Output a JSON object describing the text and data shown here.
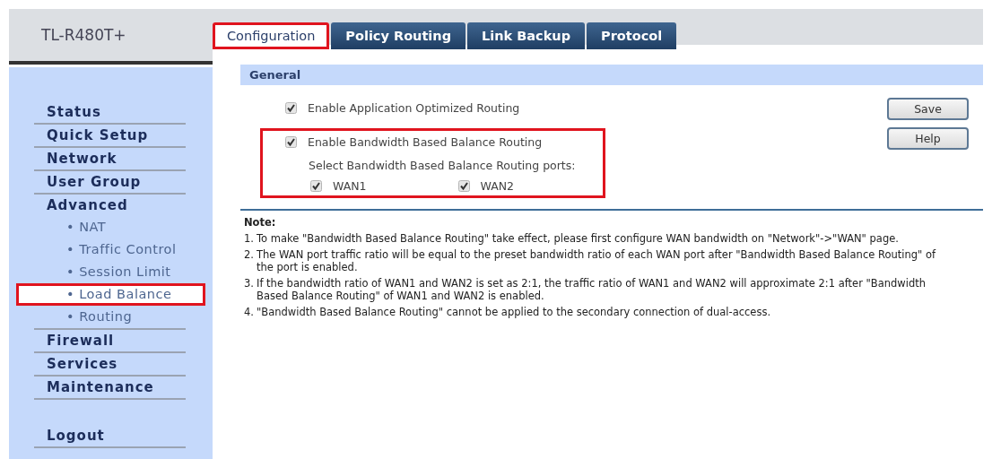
{
  "brand": "TL-R480T+",
  "tabs": [
    {
      "label": "Configuration",
      "selected": true,
      "highlighted": true
    },
    {
      "label": "Policy Routing",
      "selected": false,
      "highlighted": false
    },
    {
      "label": "Link Backup",
      "selected": false,
      "highlighted": false
    },
    {
      "label": "Protocol",
      "selected": false,
      "highlighted": false
    }
  ],
  "sidebar": {
    "items": [
      {
        "label": "Status",
        "kind": "section",
        "selected": false,
        "highlighted": false
      },
      {
        "label": "Quick Setup",
        "kind": "section",
        "selected": false,
        "highlighted": false
      },
      {
        "label": "Network",
        "kind": "section",
        "selected": false,
        "highlighted": false
      },
      {
        "label": "User Group",
        "kind": "section",
        "selected": false,
        "highlighted": false
      },
      {
        "label": "Advanced",
        "kind": "section",
        "selected": false,
        "highlighted": false,
        "children": [
          {
            "label": "• NAT",
            "selected": false,
            "highlighted": false
          },
          {
            "label": "• Traffic Control",
            "selected": false,
            "highlighted": false
          },
          {
            "label": "• Session Limit",
            "selected": false,
            "highlighted": false
          },
          {
            "label": "• Load Balance",
            "selected": true,
            "highlighted": true
          },
          {
            "label": "• Routing",
            "selected": false,
            "highlighted": false
          }
        ]
      },
      {
        "label": "Firewall",
        "kind": "section",
        "selected": false,
        "highlighted": false
      },
      {
        "label": "Services",
        "kind": "section",
        "selected": false,
        "highlighted": false
      },
      {
        "label": "Maintenance",
        "kind": "section",
        "selected": false,
        "highlighted": false
      },
      {
        "label": "Logout",
        "kind": "logout",
        "selected": false,
        "highlighted": false
      }
    ]
  },
  "general": {
    "title": "General",
    "options": [
      {
        "label": "Enable Application Optimized Routing",
        "checked": true
      }
    ],
    "bandwidth_group": {
      "highlighted": true,
      "option": {
        "label": "Enable Bandwidth Based Balance Routing",
        "checked": true
      },
      "ports_label": "Select Bandwidth Based Balance Routing ports:",
      "ports": [
        {
          "label": "WAN1",
          "checked": true
        },
        {
          "label": "WAN2",
          "checked": true
        }
      ]
    },
    "buttons": [
      "Save",
      "Help"
    ]
  },
  "note": {
    "title": "Note:",
    "items": [
      {
        "number": "1.",
        "text": "To make \"Bandwidth Based Balance Routing\" take effect, please first configure WAN bandwidth on \"Network\"->\"WAN\" page."
      },
      {
        "number": "2.",
        "text": "The WAN port traffic ratio will be equal to the preset bandwidth ratio of each WAN port after \"Bandwidth Based Balance Routing\" of the port is enabled."
      },
      {
        "number": "3.",
        "text": "If the bandwidth ratio of WAN1 and WAN2 is set as 2:1, the traffic ratio of WAN1 and WAN2 will approximate 2:1 after \"Bandwidth Based Balance Routing\" of WAN1 and WAN2 is enabled."
      },
      {
        "number": "4.",
        "text": "\"Bandwidth Based Balance Routing\" cannot be applied to the secondary connection of dual-access."
      }
    ]
  }
}
